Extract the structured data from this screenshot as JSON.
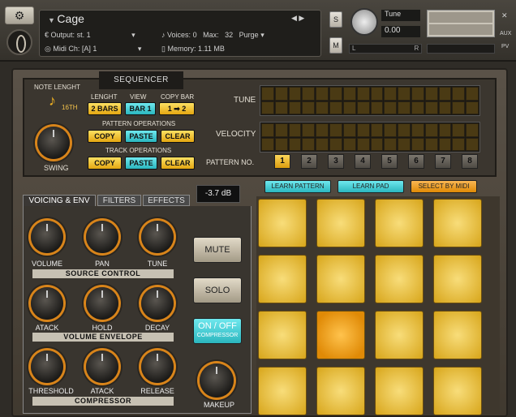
{
  "header": {
    "instrument_name": "Cage",
    "output_label": "Output:",
    "output_value": "st. 1",
    "voices_label": "Voices:",
    "voices_value": "0",
    "max_label": "Max:",
    "max_value": "32",
    "purge_label": "Purge",
    "midi_label": "Midi Ch:",
    "midi_value": "[A] 1",
    "memory_label": "Memory:",
    "memory_value": "1.11 MB",
    "s_label": "S",
    "m_label": "M",
    "tune_label": "Tune",
    "tune_value": "0.00",
    "pan_l": "L",
    "pan_r": "R",
    "aux_label": "AUX",
    "pv_label": "PV"
  },
  "sequencer": {
    "tab_label": "SEQUENCER",
    "note_length_label": "NOTE LENGHT",
    "note_value": "16th",
    "lenght_label": "LENGHT",
    "view_label": "VIEW",
    "copy_bar_label": "COPY BAR",
    "two_bars": "2 BARS",
    "bar1": "BAR 1",
    "copy_bar_value": "1 ➡ 2",
    "pattern_ops_label": "PATTERN OPERATIONS",
    "track_ops_label": "TRACK OPERATIONS",
    "copy": "COPY",
    "paste": "PASTE",
    "clear": "CLEAR",
    "swing_label": "SWING",
    "tune_label": "TUNE",
    "velocity_label": "VELOCITY",
    "pattern_no_label": "PATTERN NO.",
    "patterns": [
      "1",
      "2",
      "3",
      "4",
      "5",
      "6",
      "7",
      "8"
    ],
    "active_pattern": 1
  },
  "voicing": {
    "tabs": [
      "VOICING & ENV",
      "FILTERS",
      "EFFECTS"
    ],
    "active_tab": "VOICING & ENV",
    "db_value": "-3.7 dB",
    "source_knobs": [
      "VOLUME",
      "PAN",
      "TUNE"
    ],
    "source_section": "SOURCE  CONTROL",
    "env_knobs": [
      "ATACK",
      "HOLD",
      "DECAY"
    ],
    "env_section": "VOLUME  ENVELOPE",
    "comp_knobs": [
      "THRESHOLD",
      "ATACK",
      "RELEASE"
    ],
    "comp_section": "COMPRESSOR",
    "mute": "MUTE",
    "solo": "SOLO",
    "onoff": "ON / OFF",
    "compressor": "COMPRESSOR",
    "makeup": "MAKEUP"
  },
  "pads": {
    "learn_pattern": "LEARN PATTERN",
    "learn_pad": "LEARN PAD",
    "select_by_midi": "SELECT BY MIDI",
    "active_pad": 9
  },
  "colors": {
    "yellow": "#f4c32c",
    "cyan": "#3cc8d0",
    "orange": "#e08a06"
  }
}
